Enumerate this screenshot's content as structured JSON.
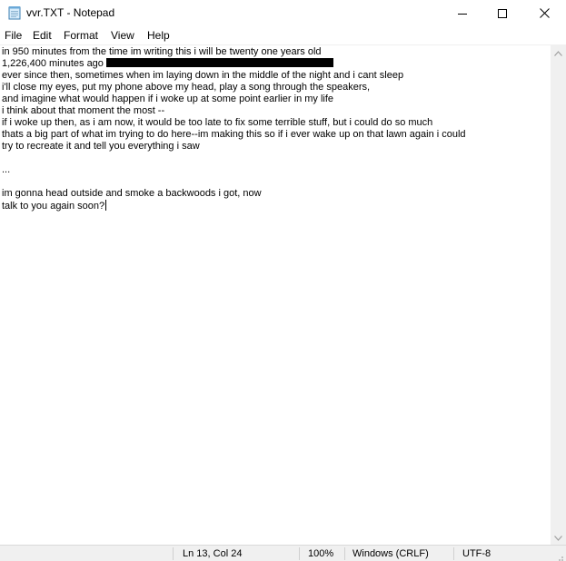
{
  "window": {
    "title": "vvr.TXT - Notepad",
    "icon": "notepad-icon",
    "controls": [
      "minimize-icon",
      "maximize-icon",
      "close-icon"
    ]
  },
  "menu": {
    "file": "File",
    "edit": "Edit",
    "format": "Format",
    "view": "View",
    "help": "Help"
  },
  "document": {
    "lines": [
      "in 950 minutes from the time im writing this i will be twenty one years old",
      "1,226,400 minutes ago",
      "ever since then, sometimes when im laying down in the middle of the night and i cant sleep",
      "i'll close my eyes, put my phone above my head, play a song through the speakers,",
      "and imagine what would happen if i woke up at some point earlier in my life",
      "i think about that moment the most --",
      "if i woke up then, as i am now, it would be too late to fix some terrible stuff, but i could do so much",
      "thats a big part of what im trying to do here--im making this so if i ever wake up on that lawn again i could",
      "try to recreate it and tell you everything i saw",
      "",
      "...",
      "",
      "im gonna head outside and smoke a backwoods i got, now",
      "talk to you again soon?"
    ]
  },
  "status": {
    "position": "Ln 13, Col 24",
    "zoom": "100%",
    "line_endings": "Windows (CRLF)",
    "encoding": "UTF-8"
  }
}
